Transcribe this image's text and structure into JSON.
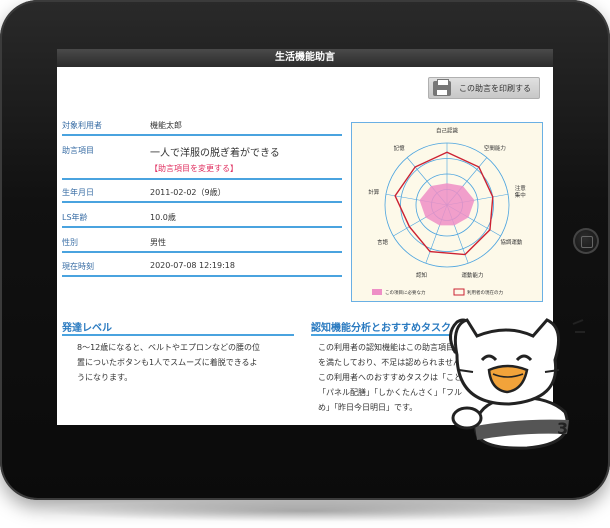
{
  "header": {
    "title": "生活機能助言"
  },
  "toolbar": {
    "print_label": "この助言を印刷する"
  },
  "info": [
    {
      "label": "対象利用者",
      "value": "機能太郎"
    },
    {
      "label": "助言項目",
      "value": "一人で洋服の脱ぎ着ができる",
      "change_link": "【助言項目を変更する】"
    },
    {
      "label": "生年月日",
      "value": "2011-02-02（9歳）"
    },
    {
      "label": "LS年齢",
      "value": "10.0歳"
    },
    {
      "label": "性別",
      "value": "男性"
    },
    {
      "label": "現在時刻",
      "value": "2020-07-08 12:19:18"
    }
  ],
  "radar": {
    "axes": [
      "自己認識",
      "空間能力",
      "注意集中",
      "協調運動",
      "運動能力",
      "認知",
      "言語",
      "計算",
      "記憶"
    ],
    "required": [
      0.35,
      0.4,
      0.45,
      0.4,
      0.35,
      0.35,
      0.4,
      0.45,
      0.4
    ],
    "current": [
      0.85,
      0.8,
      0.75,
      0.8,
      0.85,
      0.8,
      0.7,
      0.85,
      0.8
    ],
    "legend": {
      "required": "この項目に必要な力",
      "current": "利用者の現在の力"
    },
    "colors": {
      "required_fill": "#ee8fc6",
      "current_stroke": "#cc2233",
      "grid": "#4aa3df"
    }
  },
  "development": {
    "title": "発達レベル",
    "text_lines": [
      "8～12歳になると、ベルトやエプロンなどの腰の位",
      "置についたボタンも1人でスムーズに着脱できるよ",
      "うになります。"
    ]
  },
  "analysis": {
    "title": "認知機能分析とおすすめタスク",
    "text_lines": [
      "この利用者の認知機能はこの助言項目の必要",
      "を満たしており、不足は認められません。",
      "この利用者へのおすすめタスクは「ことり",
      "「パネル配膳」「しかくたんさく」「フル",
      "め」「昨日今日明日」です。"
    ]
  },
  "mascot": {
    "label": "3"
  }
}
